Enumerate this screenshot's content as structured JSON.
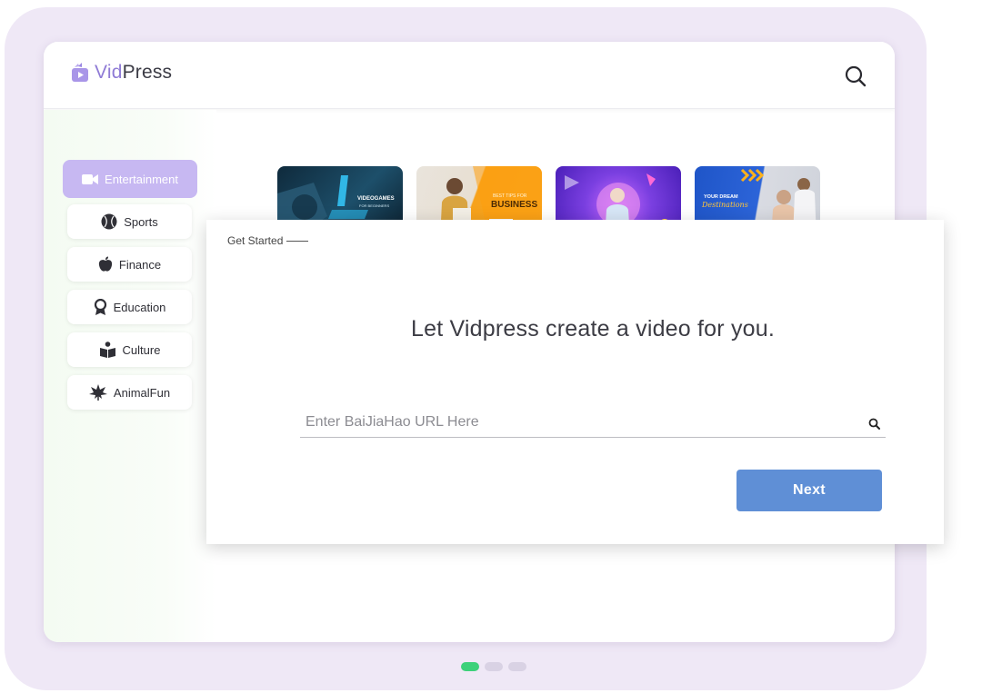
{
  "app": {
    "brand_vid": "Vid",
    "brand_press": "Press"
  },
  "sidebar": {
    "items": [
      {
        "label": "Entertainment",
        "icon": "video-camera-icon",
        "active": true
      },
      {
        "label": "Sports",
        "icon": "ball-icon",
        "active": false
      },
      {
        "label": "Finance",
        "icon": "apple-icon",
        "active": false
      },
      {
        "label": "Education",
        "icon": "award-ribbon-icon",
        "active": false
      },
      {
        "label": "Culture",
        "icon": "reader-book-icon",
        "active": false
      },
      {
        "label": "AnimalFun",
        "icon": "leaf-icon",
        "active": false
      }
    ]
  },
  "thumbnails": [
    {
      "text": "VIDEOGAMES",
      "subtext": "FOR BEGINNERS",
      "theme": "dark-teal"
    },
    {
      "text": "BUSINESS",
      "subtext": "BEST TIPS FOR",
      "theme": "orange"
    },
    {
      "text": "",
      "subtext": "",
      "theme": "purple"
    },
    {
      "text": "YOUR DREAM",
      "subtext": "Destinations",
      "theme": "blue"
    }
  ],
  "modal": {
    "section_label": "Get Started",
    "headline": "Let Vidpress create a video for you.",
    "url_placeholder": "Enter BaiJiaHao URL Here",
    "next_label": "Next"
  },
  "pagination": {
    "count": 3,
    "active_index": 0
  },
  "colors": {
    "accent": "#c7b8f2",
    "brand": "#8f7bd6",
    "button": "#5f8fd6",
    "active_dot": "#3dd17a"
  }
}
